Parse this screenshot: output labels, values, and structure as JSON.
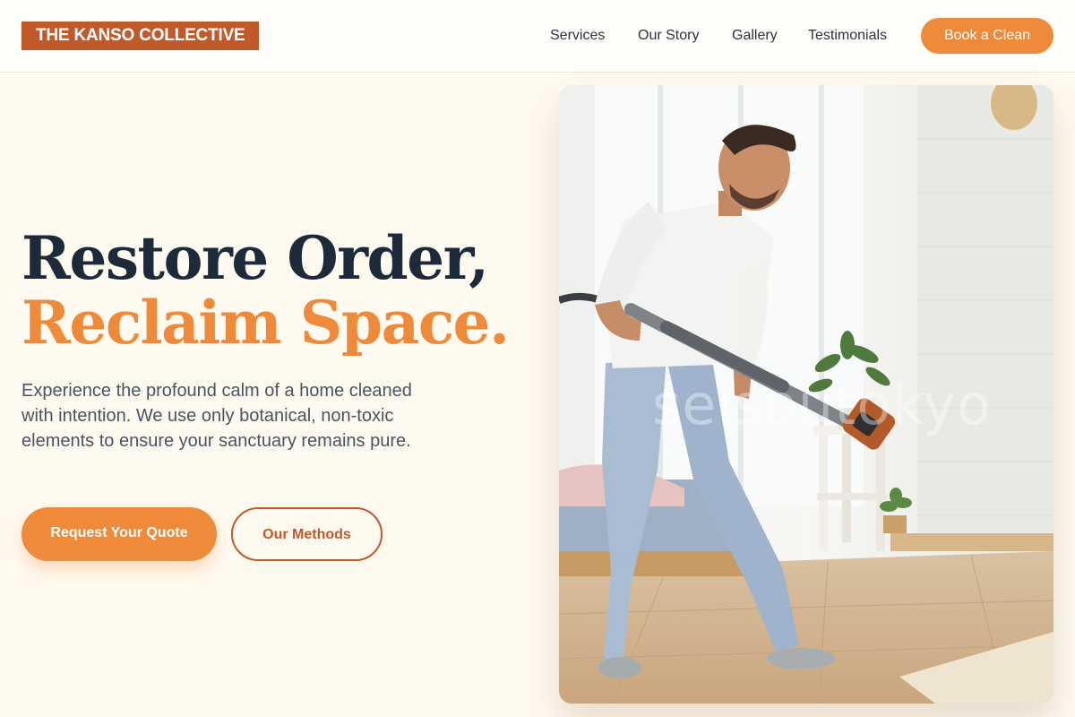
{
  "header": {
    "brand": "THE KANSO COLLECTIVE",
    "nav": [
      "Services",
      "Our Story",
      "Gallery",
      "Testimonials"
    ],
    "cta": "Book a Clean"
  },
  "hero": {
    "headline_line1": "Restore Order,",
    "headline_line2": "Reclaim Space.",
    "subtext": "Experience the profound calm of a home cleaned with intention. We use only botanical, non-toxic elements to ensure your sanctuary remains pure.",
    "primary_button": "Request Your Quote",
    "secondary_button": "Our Methods",
    "image_watermark": "seisoutokyo"
  },
  "colors": {
    "accent": "#ee8a3a",
    "brand": "#c1592a",
    "heading": "#1d2a3a",
    "background": "#fffaf0"
  }
}
